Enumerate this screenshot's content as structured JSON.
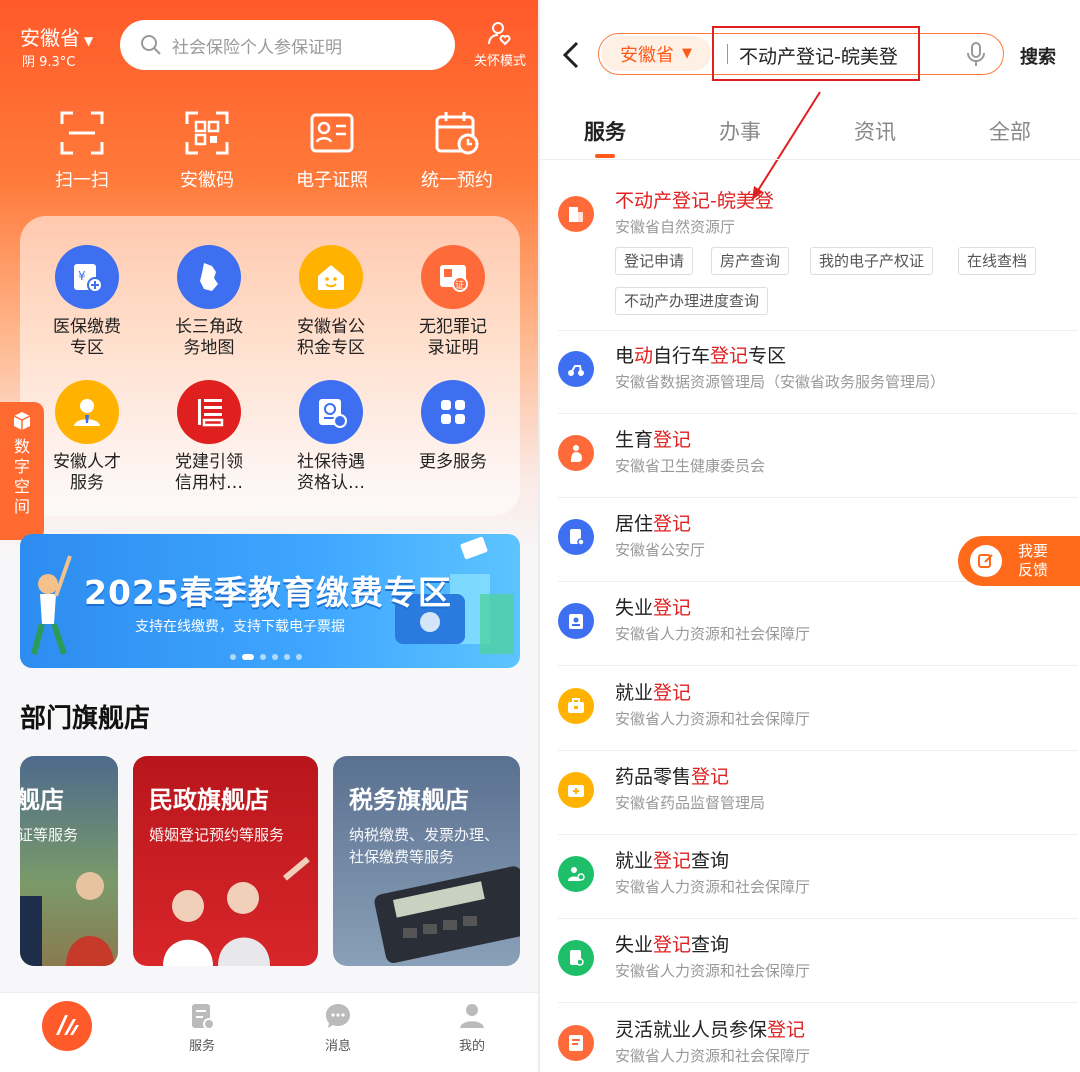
{
  "left": {
    "province": "安徽省",
    "weather": "阴 9.3°C",
    "search_placeholder": "社会保险个人参保证明",
    "care_mode": "关怀模式",
    "quick_actions": [
      "扫一扫",
      "安徽码",
      "电子证照",
      "统一预约"
    ],
    "services": [
      {
        "line1": "医保缴费",
        "line2": "专区",
        "color": "#3d6ff0"
      },
      {
        "line1": "长三角政",
        "line2": "务地图",
        "color": "#3d6ff0"
      },
      {
        "line1": "安徽省公",
        "line2": "积金专区",
        "color": "#ffb300"
      },
      {
        "line1": "无犯罪记",
        "line2": "录证明",
        "color": "#ff6a3a"
      },
      {
        "line1": "安徽人才",
        "line2": "服务",
        "color": "#ffb300"
      },
      {
        "line1": "党建引领",
        "line2": "信用村…",
        "color": "#e0201e"
      },
      {
        "line1": "社保待遇",
        "line2": "资格认…",
        "color": "#3d6ff0"
      },
      {
        "line1": "更多服务",
        "line2": "",
        "color": "#3d6ff0"
      }
    ],
    "side_tab": [
      "数",
      "字",
      "空",
      "间"
    ],
    "banner_title": "2025春季教育缴费专区",
    "banner_sub": "支持在线缴费，支持下载电子票据",
    "section_title": "部门旗舰店",
    "stores": [
      {
        "title": "舰店",
        "desc": "证等服务"
      },
      {
        "title": "民政旗舰店",
        "desc": "婚姻登记预约等服务"
      },
      {
        "title": "税务旗舰店",
        "desc": "纳税缴费、发票办理、社保缴费等服务"
      }
    ],
    "tabbar": [
      "服务",
      "消息",
      "我的"
    ]
  },
  "right": {
    "province": "安徽省",
    "query": "不动产登记-皖美登",
    "search_btn": "搜索",
    "tabs": [
      "服务",
      "办事",
      "资讯",
      "全部"
    ],
    "results": [
      {
        "pre": "不动产登记-皖美登",
        "hl": "",
        "post": "",
        "sub": "安徽省自然资源厅",
        "color": "#ff6a3a",
        "all_red": true
      },
      {
        "pre": "电",
        "hl": "动",
        "post": "自行车",
        "hl2": "登记",
        "post2": "专区",
        "sub": "安徽省数据资源管理局（安徽省政务服务管理局）",
        "color": "#3d6ff0"
      },
      {
        "pre": "生育",
        "hl": "登记",
        "post": "",
        "sub": "安徽省卫生健康委员会",
        "color": "#ff6a3a"
      },
      {
        "pre": "居住",
        "hl": "登记",
        "post": "",
        "sub": "安徽省公安厅",
        "color": "#3d6ff0"
      },
      {
        "pre": "失业",
        "hl": "登记",
        "post": "",
        "sub": "安徽省人力资源和社会保障厅",
        "color": "#3d6ff0"
      },
      {
        "pre": "就业",
        "hl": "登记",
        "post": "",
        "sub": "安徽省人力资源和社会保障厅",
        "color": "#ffb300"
      },
      {
        "pre": "药品零售",
        "hl": "登记",
        "post": "",
        "sub": "安徽省药品监督管理局",
        "color": "#ffb300"
      },
      {
        "pre": "就业",
        "hl": "登记",
        "post": "查询",
        "sub": "安徽省人力资源和社会保障厅",
        "color": "#1fbf6a"
      },
      {
        "pre": "失业",
        "hl": "登记",
        "post": "查询",
        "sub": "安徽省人力资源和社会保障厅",
        "color": "#1fbf6a"
      },
      {
        "pre": "灵活就业人员参保",
        "hl": "登记",
        "post": "",
        "sub": "安徽省人力资源和社会保障厅",
        "color": "#ff6a3a"
      }
    ],
    "chips": [
      "登记申请",
      "房产查询",
      "我的电子产权证",
      "在线查档",
      "不动产办理进度查询"
    ],
    "feedback": [
      "我要",
      "反馈"
    ]
  },
  "colors": {
    "accent": "#ff5a1a",
    "highlight": "#e02020"
  }
}
